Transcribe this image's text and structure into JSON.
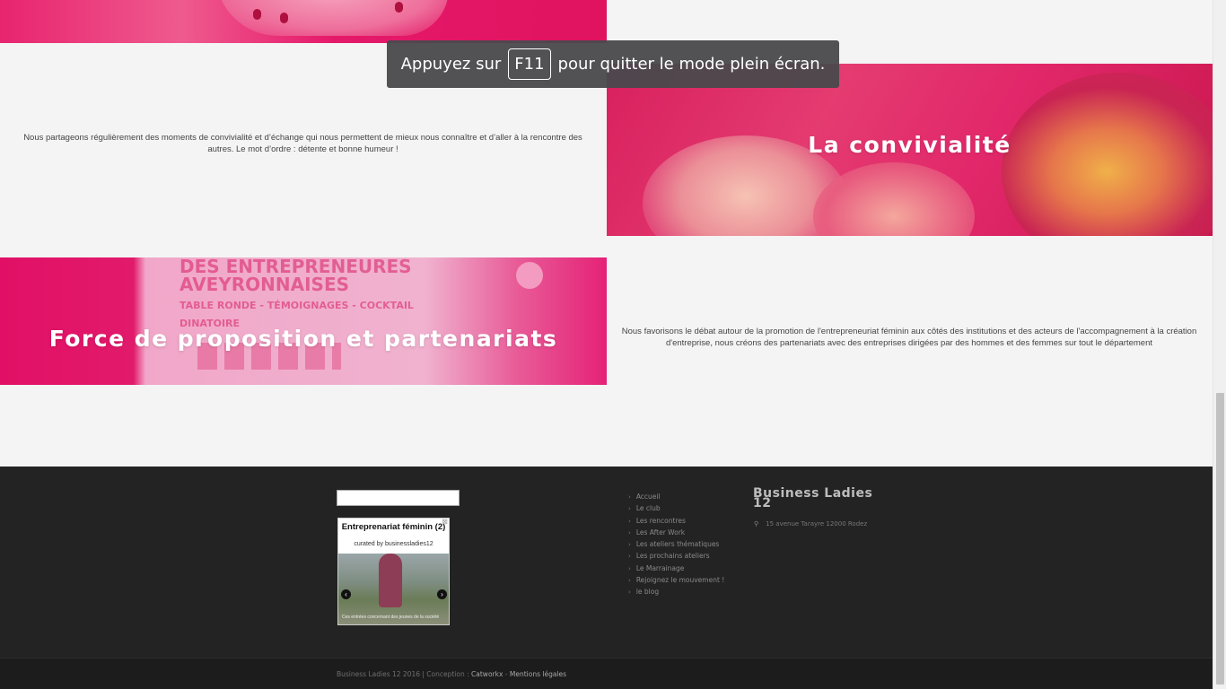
{
  "fullscreen_notice": {
    "before": "Appuyez sur",
    "key": "F11",
    "after": "pour quitter le mode plein écran."
  },
  "sections": {
    "convivialite": {
      "title": "La convivialité",
      "text": "Nous partageons régulièrement des moments de convivialité et d’échange qui nous permettent de mieux nous connaître et d’aller à la rencontre des autres. Le mot d’ordre : détente et bonne humeur !"
    },
    "force": {
      "title": "Force de proposition et partenariats",
      "banner_line1": "DES ENTREPRENEURES",
      "banner_line2": "AVEYRONNAISES",
      "banner_line3": "TABLE RONDE - TÉMOIGNAGES - COCKTAIL DINATOIRE",
      "text": "Nous favorisons le débat autour de la promotion de l'entrepreneuriat féminin aux côtés des institutions et des acteurs de l'accompagnement à la création d'entreprise, nous créons des partenariats avec des entreprises dirigées par des hommes et des femmes sur tout le département"
    }
  },
  "footer": {
    "widget": {
      "title": "Entreprenariat féminin (2)",
      "subtitle": "curated by businessladies12",
      "caption": "Ces entrées concernant des jeunes de la société",
      "close": "⊠",
      "prev": "‹",
      "next": "›"
    },
    "menu": [
      "Accueil",
      "Le club",
      "Les rencontres",
      "Les After Work",
      "Les ateliers thématiques",
      "Les prochains ateliers",
      "Le Marrainage",
      "Rejoignez le mouvement !",
      "le blog"
    ],
    "brand": {
      "line1": "Business Ladies",
      "line2": "12",
      "address": "15 avenue Tarayre 12000 Rodez"
    },
    "copyright": {
      "text": "Business Ladies 12  2016 | Conception : ",
      "link1": "Catworkx",
      "sep": " - ",
      "link2": "Mentions légales"
    }
  },
  "colors": {
    "accent_pink": "#e2195f",
    "footer_bg": "#232323",
    "page_bg": "#f4f4f4"
  }
}
